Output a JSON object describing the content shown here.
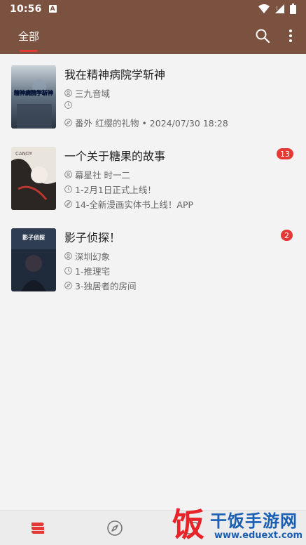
{
  "status_bar": {
    "time": "10:56",
    "notification_icon": "a-box-icon",
    "icons": [
      "wifi-icon",
      "signal-icon",
      "battery-icon"
    ]
  },
  "app_bar": {
    "tab_label": "全部",
    "accent_color": "#7b5140",
    "indicator_color": "#e53935",
    "actions": [
      "search-icon",
      "more-vert-icon"
    ]
  },
  "comics": [
    {
      "title": "我在精神病院学斩神",
      "author": "三九音域",
      "latest_update": "",
      "last_read": "番外 红缨的礼物 • 2024/07/30 18:28",
      "badge": "",
      "cover_text": "精神病院学斩神"
    },
    {
      "title": "一个关于糖果的故事",
      "author": "幕星社 时一二",
      "latest_update": "1-2月1日正式上线！",
      "last_read": "14-全新漫画实体书上线！APP",
      "badge": "13",
      "cover_text": "CANDY"
    },
    {
      "title": "影子侦探！",
      "author": "深圳幻象",
      "latest_update": "1-推理宅",
      "last_read": "3-独居者的房间",
      "badge": "2",
      "cover_text": "影子侦探"
    }
  ],
  "bottom_nav": [
    "bookshelf-icon",
    "explore-compass-icon",
    "more-icon"
  ],
  "watermark": {
    "logo_char": "饭",
    "name": "干饭手游网",
    "url": "www.eduext.com"
  }
}
